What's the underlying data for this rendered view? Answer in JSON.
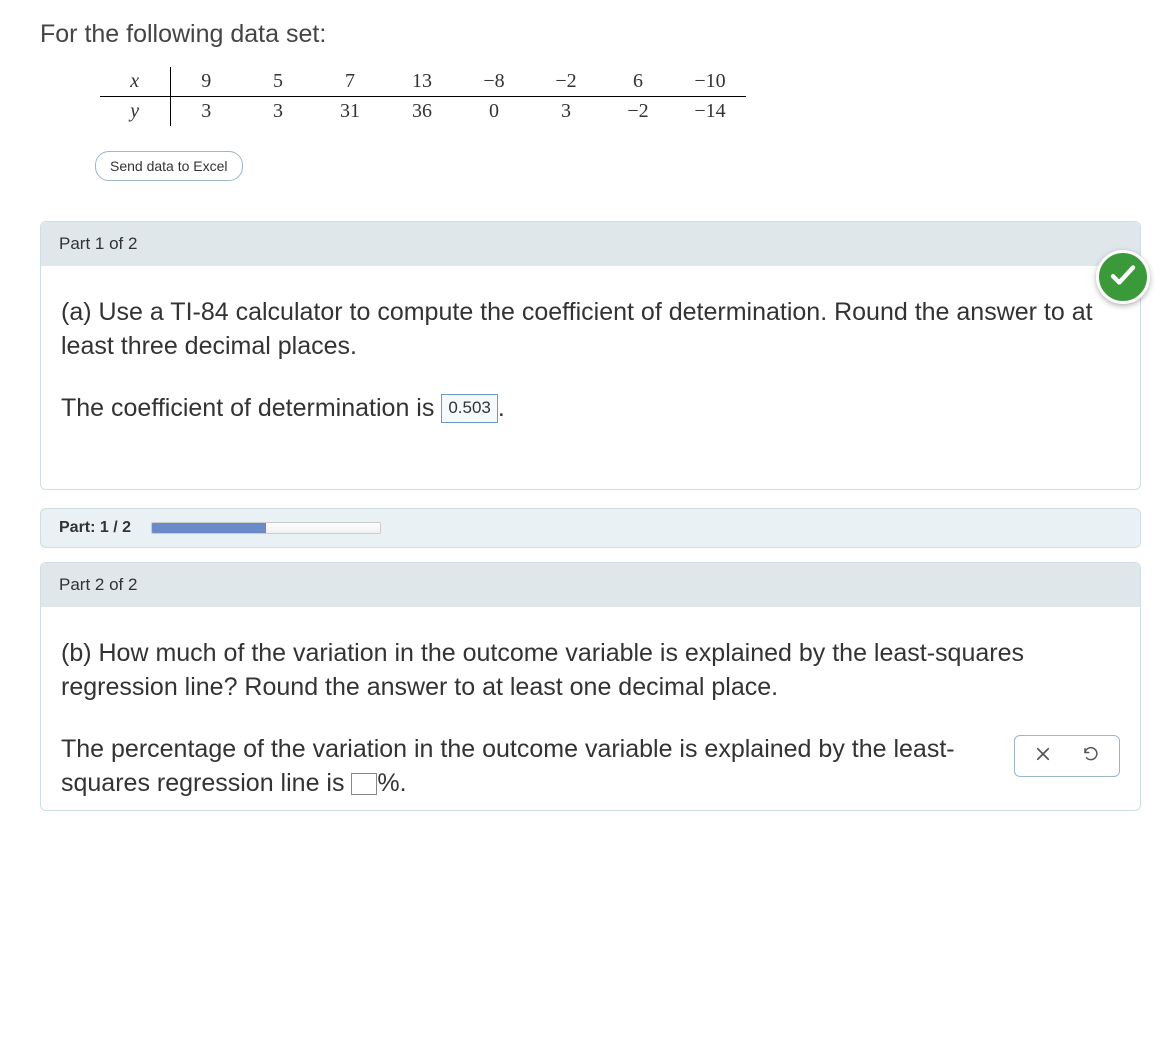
{
  "intro": "For the following data set:",
  "table": {
    "row_labels": [
      "x",
      "y"
    ],
    "x": [
      "9",
      "5",
      "7",
      "13",
      "−8",
      "−2",
      "6",
      "−10"
    ],
    "y": [
      "3",
      "3",
      "31",
      "36",
      "0",
      "3",
      "−2",
      "−14"
    ]
  },
  "excel_button": "Send data to Excel",
  "part1": {
    "header": "Part 1 of 2",
    "question": "(a) Use a TI-84 calculator to compute the coefficient of determination. Round the answer to at least three decimal places.",
    "answer_prefix": "The coefficient of determination is ",
    "answer_value": "0.503",
    "answer_suffix": "."
  },
  "progress": {
    "label": "Part: 1 / 2",
    "percent": 50
  },
  "part2": {
    "header": "Part 2 of 2",
    "question": "(b) How much of the variation in the outcome variable is explained by the least-squares regression line? Round the answer to at least one decimal place.",
    "answer_prefix": "The percentage of the variation in the outcome variable is explained by the least-squares regression line is ",
    "answer_value": "",
    "answer_suffix": "%."
  },
  "chart_data": {
    "type": "table",
    "title": "Data set",
    "columns": [
      "x",
      "y"
    ],
    "rows": [
      [
        9,
        3
      ],
      [
        5,
        3
      ],
      [
        7,
        31
      ],
      [
        13,
        36
      ],
      [
        -8,
        0
      ],
      [
        -2,
        3
      ],
      [
        6,
        -2
      ],
      [
        -10,
        -14
      ]
    ]
  }
}
